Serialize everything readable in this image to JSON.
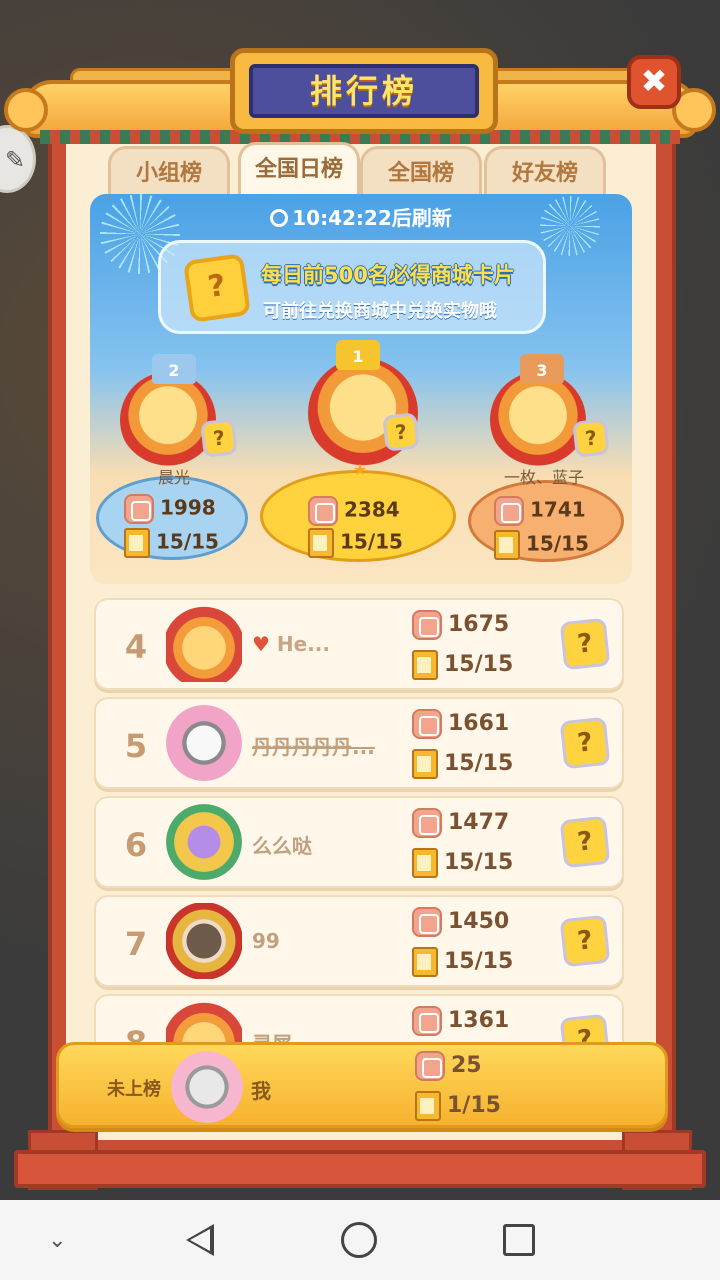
{
  "header": {
    "title": "排行榜",
    "close_glyph": "✖"
  },
  "tabs": [
    {
      "label": "小组榜",
      "active": false
    },
    {
      "label": "全国日榜",
      "active": true
    },
    {
      "label": "全国榜",
      "active": false
    },
    {
      "label": "好友榜",
      "active": false
    }
  ],
  "top_panel": {
    "refresh_time": "10:42:22",
    "refresh_suffix": "后刷新",
    "banner_line1": "每日前500名必得商城卡片",
    "banner_line2": "可前往兑换商城中兑换实物哦",
    "banner_card_glyph": "?"
  },
  "podium": [
    {
      "place": "2",
      "name": "晨光",
      "score": "1998",
      "progress": "15/15"
    },
    {
      "place": "1",
      "name": "★",
      "score": "2384",
      "progress": "15/15"
    },
    {
      "place": "3",
      "name": "一枚、蓝子",
      "score": "1741",
      "progress": "15/15"
    }
  ],
  "rows": [
    {
      "rank": "4",
      "name": "He...",
      "heart": "♥",
      "score": "1675",
      "progress": "15/15"
    },
    {
      "rank": "5",
      "name": "丹丹丹丹丹...",
      "score": "1661",
      "progress": "15/15"
    },
    {
      "rank": "6",
      "name": "么么哒",
      "score": "1477",
      "progress": "15/15"
    },
    {
      "rank": "7",
      "name": "99",
      "score": "1450",
      "progress": "15/15"
    },
    {
      "rank": "8",
      "name": "灵犀",
      "score": "1361",
      "progress": ""
    }
  ],
  "me": {
    "rank_label": "未上榜",
    "name": "我",
    "score": "25",
    "progress": "1/15"
  },
  "card_glyph": "?",
  "colors": {
    "frame": "#c84f34",
    "accent": "#f7b940",
    "panel_bg": "#fbeed3"
  }
}
